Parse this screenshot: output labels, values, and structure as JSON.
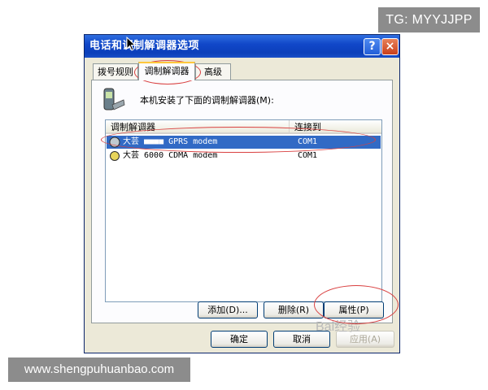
{
  "watermarks": {
    "top_right": "TG: MYYJJPP",
    "bottom_left": "www.shengpuhuanbao.com",
    "overlay": "Bai经验"
  },
  "dialog": {
    "title": "电话和调制解调器选项",
    "help_button": "?",
    "close_button": "×"
  },
  "tabs": [
    {
      "label": "拨号规则"
    },
    {
      "label": "调制解调器"
    },
    {
      "label": "高级"
    }
  ],
  "panel": {
    "description": "本机安装了下面的调制解调器(M):",
    "columns": {
      "modem": "调制解调器",
      "attached_to": "连接到"
    },
    "rows": [
      {
        "name": "大芸 ■■■■ GPRS modem",
        "port": "COM1",
        "selected": true
      },
      {
        "name": "大芸 6000 CDMA modem",
        "port": "COM1",
        "selected": false
      }
    ],
    "buttons": {
      "add": "添加(D)...",
      "remove": "删除(R)",
      "properties": "属性(P)"
    }
  },
  "footer": {
    "ok": "确定",
    "cancel": "取消",
    "apply": "应用(A)"
  },
  "colors": {
    "title_bar": "#0b3fba",
    "selection": "#316ac5",
    "annotation": "#d94040"
  }
}
